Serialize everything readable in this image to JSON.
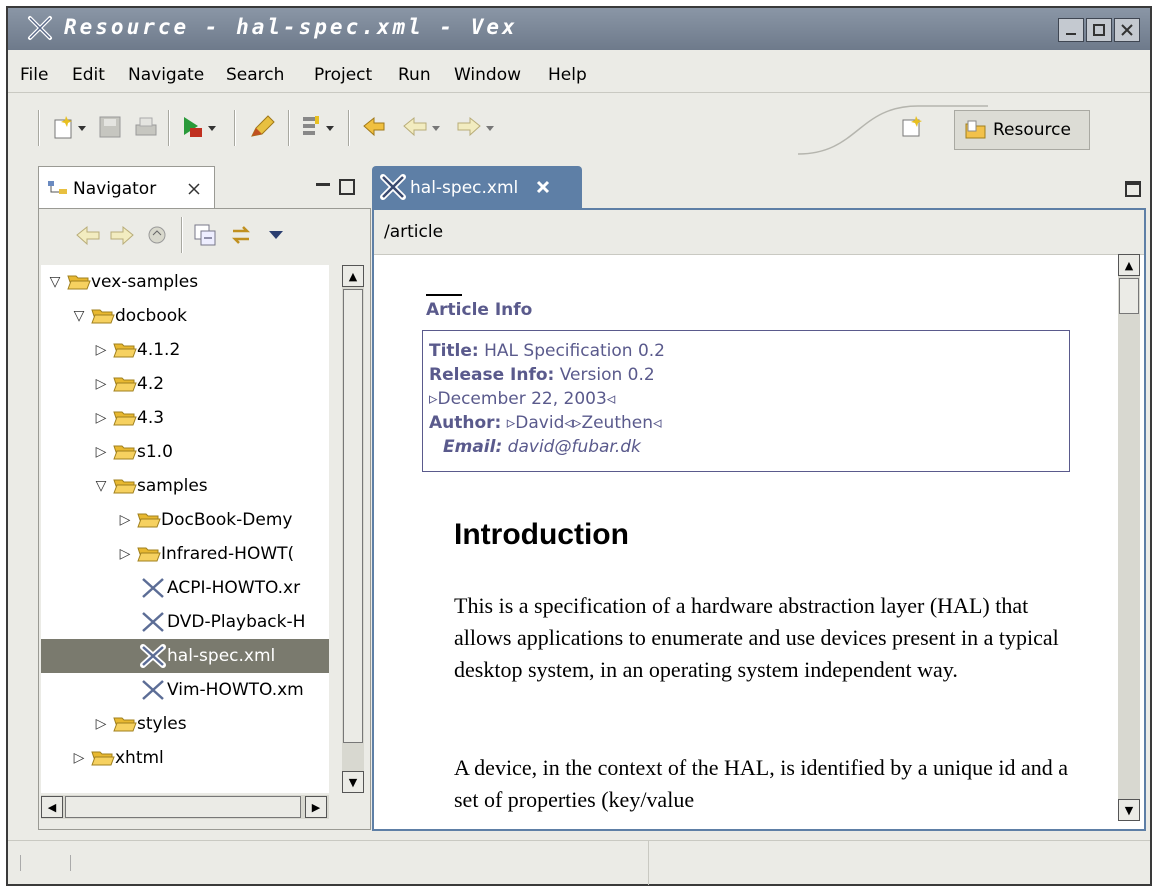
{
  "window": {
    "title": "Resource - hal-spec.xml - Vex"
  },
  "menu": [
    "File",
    "Edit",
    "Navigate",
    "Search",
    "Project",
    "Run",
    "Window",
    "Help"
  ],
  "toolbar": {
    "icons": [
      "new-icon",
      "save-icon",
      "print-icon",
      "run-icon",
      "pencil-icon",
      "properties-icon",
      "last-edit-icon",
      "back-icon",
      "forward-icon"
    ],
    "perspective_label": "Resource"
  },
  "navigator": {
    "tab_label": "Navigator",
    "tree": [
      {
        "label": "vex-samples",
        "type": "folder",
        "level": 0,
        "expanded": true
      },
      {
        "label": "docbook",
        "type": "folder",
        "level": 1,
        "expanded": true
      },
      {
        "label": "4.1.2",
        "type": "folder",
        "level": 2,
        "expanded": false
      },
      {
        "label": "4.2",
        "type": "folder",
        "level": 2,
        "expanded": false
      },
      {
        "label": "4.3",
        "type": "folder",
        "level": 2,
        "expanded": false
      },
      {
        "label": "s1.0",
        "type": "folder",
        "level": 2,
        "expanded": false
      },
      {
        "label": "samples",
        "type": "folder",
        "level": 2,
        "expanded": true
      },
      {
        "label": "DocBook-Demy",
        "type": "folder",
        "level": 3,
        "expanded": false
      },
      {
        "label": "Infrared-HOWT(",
        "type": "folder",
        "level": 3,
        "expanded": false
      },
      {
        "label": "ACPI-HOWTO.xr",
        "type": "file",
        "level": 3
      },
      {
        "label": "DVD-Playback-H",
        "type": "file",
        "level": 3
      },
      {
        "label": "hal-spec.xml",
        "type": "file",
        "level": 3,
        "selected": true
      },
      {
        "label": "Vim-HOWTO.xm",
        "type": "file",
        "level": 3
      },
      {
        "label": "styles",
        "type": "folder",
        "level": 2,
        "expanded": false
      },
      {
        "label": "xhtml",
        "type": "folder",
        "level": 1,
        "expanded": false
      }
    ]
  },
  "editor": {
    "tab_label": "hal-spec.xml",
    "breadcrumb": "/article",
    "article_info": {
      "heading": "Article Info",
      "title_label": "Title:",
      "title_value": "HAL Specification 0.2",
      "release_label": "Release Info:",
      "release_value": "Version 0.2",
      "date": "▹December 22, 2003◃",
      "author_label": "Author:",
      "author_value": "▹David◃▹Zeuthen◃",
      "email_label": "Email:",
      "email_value": "david@fubar.dk"
    },
    "section_title": "Introduction",
    "paragraphs": [
      "This is a specification of a hardware abstraction layer (HAL) that allows applications to enumerate and use devices present in a typical desktop system, in an operating system independent way.",
      "A device, in the context of the HAL, is identified by a unique id and a set of properties (key/value"
    ]
  }
}
